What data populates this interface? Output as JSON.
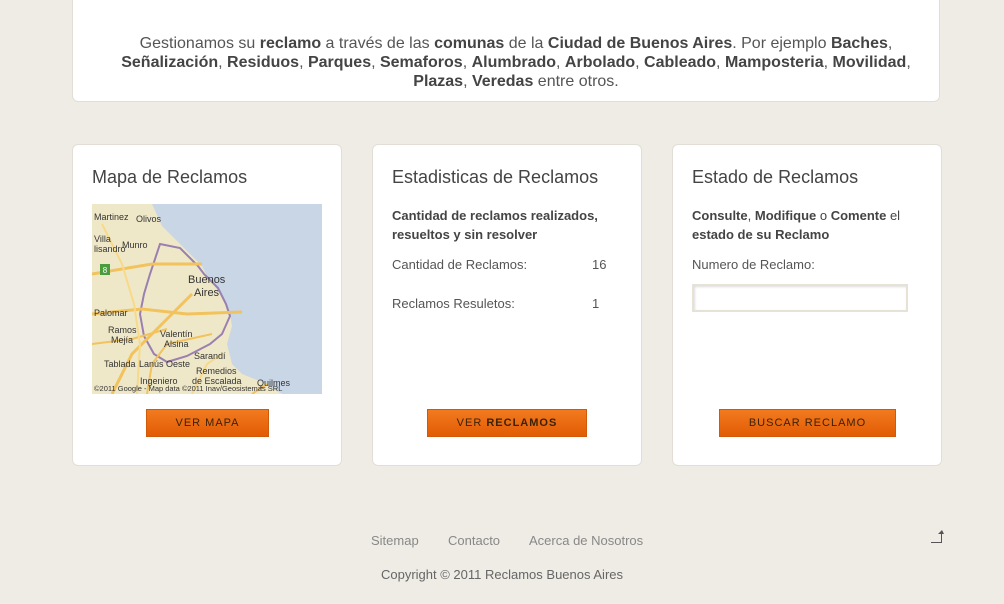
{
  "intro": {
    "segments": [
      {
        "t": "Gestionamos su ",
        "b": false
      },
      {
        "t": "reclamo",
        "b": true
      },
      {
        "t": " a través de las ",
        "b": false
      },
      {
        "t": "comunas",
        "b": true
      },
      {
        "t": " de la ",
        "b": false
      },
      {
        "t": "Ciudad de Buenos Aires",
        "b": true
      },
      {
        "t": ". Por ejemplo ",
        "b": false
      },
      {
        "t": "Baches",
        "b": true
      },
      {
        "t": ", ",
        "b": false
      },
      {
        "t": "Señalización",
        "b": true
      },
      {
        "t": ", ",
        "b": false
      },
      {
        "t": "Residuos",
        "b": true
      },
      {
        "t": ", ",
        "b": false
      },
      {
        "t": "Parques",
        "b": true
      },
      {
        "t": ", ",
        "b": false
      },
      {
        "t": "Semaforos",
        "b": true
      },
      {
        "t": ", ",
        "b": false
      },
      {
        "t": "Alumbrado",
        "b": true
      },
      {
        "t": ", ",
        "b": false
      },
      {
        "t": "Arbolado",
        "b": true
      },
      {
        "t": ", ",
        "b": false
      },
      {
        "t": "Cableado",
        "b": true
      },
      {
        "t": ", ",
        "b": false
      },
      {
        "t": "Mamposteria",
        "b": true
      },
      {
        "t": ", ",
        "b": false
      },
      {
        "t": "Movilidad",
        "b": true
      },
      {
        "t": ", ",
        "b": false
      },
      {
        "t": "Plazas",
        "b": true
      },
      {
        "t": ", ",
        "b": false
      },
      {
        "t": "Veredas",
        "b": true
      },
      {
        "t": " entre otros.",
        "b": false
      }
    ]
  },
  "map_card": {
    "title": "Mapa de Reclamos",
    "button": "VER MAPA",
    "map_labels": {
      "martinez": "Martinez",
      "olivos": "Olivos",
      "villa": "Villa",
      "lisandro": "lisandro",
      "munro": "Munro",
      "buenos": "Buenos",
      "aires": "Aires",
      "palomar": "Palomar",
      "ramos": "Ramos",
      "mejia": "Mejía",
      "valentin": "Valentín",
      "alsina": "Alsina",
      "sarandi": "Sarandí",
      "tablada": "Tablada",
      "lanus": "Lanús Oeste",
      "remedios": "Remedios",
      "escalada": "de Escalada",
      "ingeniero": "Ingeniero",
      "quilmes": "Quilmes",
      "route": "8",
      "copyright": "©2011 Google - Map data ©2011 Inav/Geosistemas SRL"
    }
  },
  "stats_card": {
    "title": "Estadisticas de Reclamos",
    "subtitle": "Cantidad de reclamos realizados, resueltos y sin resolver",
    "rows": [
      {
        "label": "Cantidad de Reclamos:",
        "value": "16"
      },
      {
        "label": "Reclamos Resuletos:",
        "value": "1"
      }
    ],
    "button_prefix": "VER ",
    "button_bold": "RECLAMOS"
  },
  "status_card": {
    "title": "Estado de Reclamos",
    "sub_parts": [
      {
        "t": "Consulte",
        "b": true
      },
      {
        "t": ", ",
        "b": false
      },
      {
        "t": "Modifique",
        "b": true
      },
      {
        "t": " o ",
        "b": false
      },
      {
        "t": "Comente",
        "b": true
      },
      {
        "t": " el ",
        "b": false
      },
      {
        "t": "estado de su Reclamo",
        "b": true
      }
    ],
    "field_label": "Numero de Reclamo:",
    "field_value": "",
    "button": "BUSCAR RECLAMO"
  },
  "footer": {
    "links": [
      "Sitemap",
      "Contacto",
      "Acerca de Nosotros"
    ],
    "copyright": "Copyright © 2011 Reclamos Buenos Aires"
  }
}
